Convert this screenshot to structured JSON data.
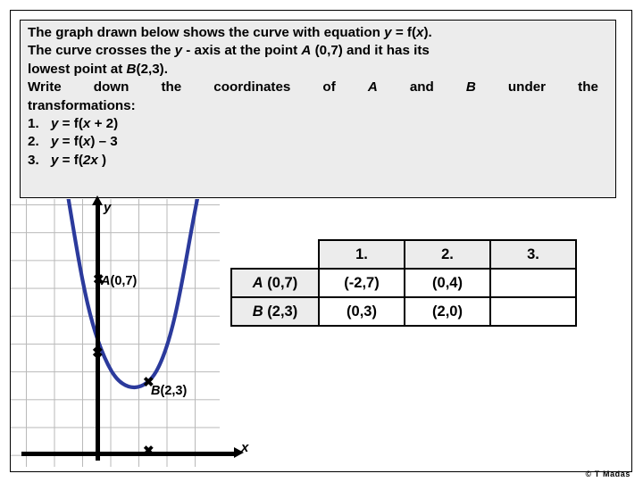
{
  "question": {
    "line1": {
      "a": "The graph drawn below shows the curve with equation ",
      "y": "y",
      "eq": " = f(",
      "x": "x",
      "end": ")."
    },
    "line2": {
      "a": "The curve crosses the ",
      "y": "y",
      "b": " - axis at the point  ",
      "A": "A",
      "coord": " (0,7) and it has its"
    },
    "line3": {
      "a": "lowest point at ",
      "B": "B",
      "coord": "(2,3)."
    },
    "line4_words": [
      "Write",
      "down",
      "the",
      "coordinates",
      "of",
      "A",
      "and",
      "B",
      "under",
      "the"
    ],
    "line5": "transformations:",
    "transformations": [
      {
        "num": "1.",
        "y": "y",
        "eq": " = f(",
        "x": "x",
        "tail": " + 2)"
      },
      {
        "num": "2.",
        "y": "y",
        "eq": " = f(",
        "x": "x",
        "tail": ") – 3"
      },
      {
        "num": "3.",
        "y": "y",
        "eq": " = f(",
        "x": "2x",
        "tail": " )"
      }
    ]
  },
  "graph": {
    "y_axis_label": "y",
    "x_axis_label": "x",
    "point_a_label_italic": "A",
    "point_a_label": "(0,7)",
    "point_b_label_italic": "B",
    "point_b_label": "(2,3)",
    "cross_glyph": "✖",
    "curve_color": "#2b3a9c",
    "grid_color": "#b9b9b9",
    "axis_color": "#000000"
  },
  "table": {
    "corner": "",
    "col_headers": [
      "1.",
      "2.",
      "3."
    ],
    "rows": [
      {
        "head_italic": "A",
        "head": " (0,7)",
        "cells": [
          "(-2,7)",
          "(0,4)",
          ""
        ]
      },
      {
        "head_italic": "B",
        "head": " (2,3)",
        "cells": [
          "(0,3)",
          "(2,0)",
          ""
        ]
      }
    ]
  },
  "footer": {
    "copyright": "© T Madas"
  },
  "chart_data": {
    "type": "line",
    "title": "",
    "xlabel": "x",
    "ylabel": "y",
    "curve_equation": "y = f(x)",
    "points": [
      {
        "name": "A",
        "x": 0,
        "y": 7,
        "note": "y-axis intercept"
      },
      {
        "name": "B",
        "x": 2,
        "y": 3,
        "note": "lowest point (vertex)"
      }
    ],
    "grid": true,
    "legend": "none",
    "xlim": [
      -3,
      7
    ],
    "ylim": [
      0,
      10
    ]
  }
}
